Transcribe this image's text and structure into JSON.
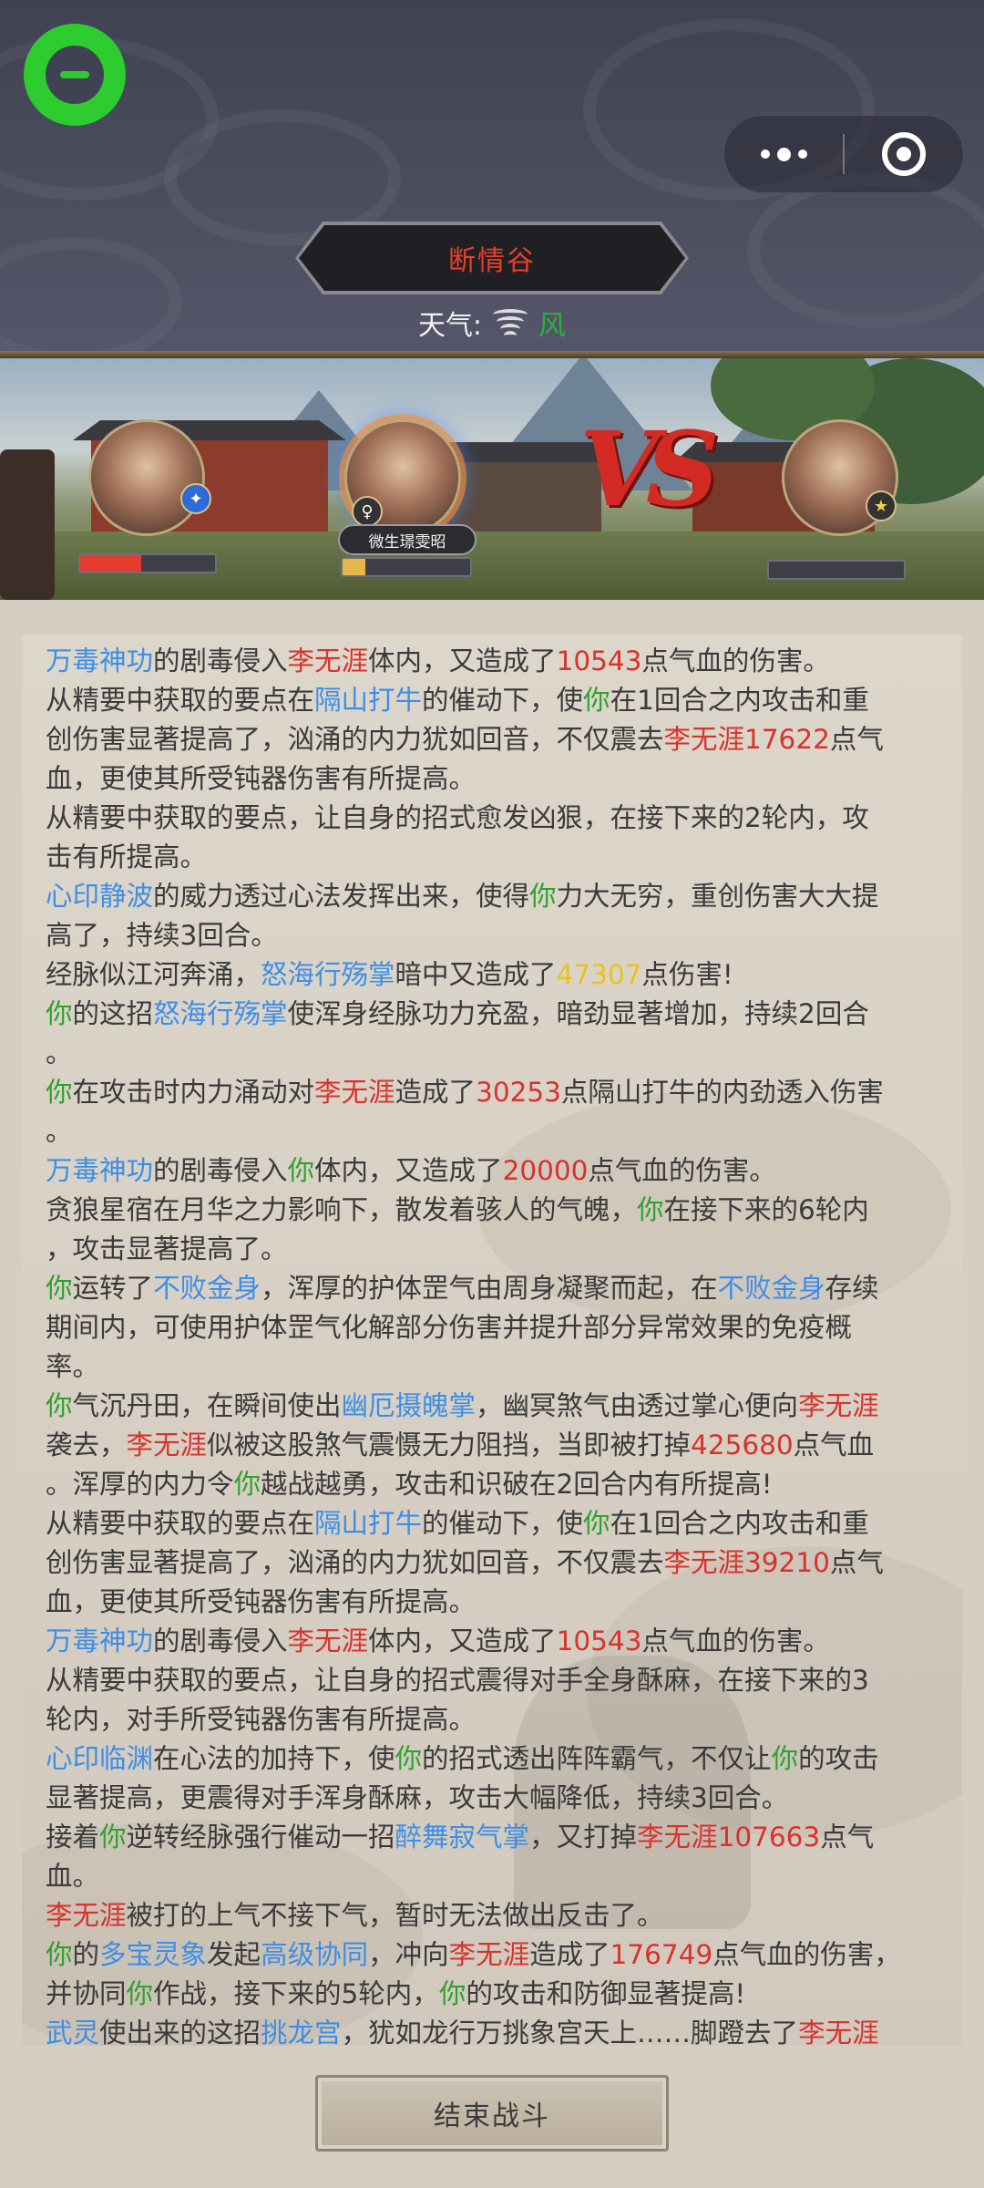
{
  "header": {
    "location": "断情谷",
    "weather_label": "天气:",
    "weather_value": "风",
    "weather_icon": "whirlwind-icon"
  },
  "battle_scene": {
    "fighters": [
      {
        "name": "",
        "hp_fraction": 0.45,
        "badge_icon": "water-element-icon"
      },
      {
        "name": "微生璟雯昭",
        "hp_fraction": 0.18,
        "badge_icon": "female-symbol-icon"
      },
      {
        "name": "",
        "hp_fraction": 0.0,
        "badge_icon": "star-icon"
      }
    ],
    "vs_text": "VS"
  },
  "colors": {
    "skill": "#3d8ee6",
    "enemy": "#d8322c",
    "self": "#2ea12e",
    "highlight": "#e8c21c"
  },
  "log": [
    [
      {
        "t": "万毒神功",
        "c": "blue"
      },
      {
        "t": "的剧毒侵入"
      },
      {
        "t": "李无涯",
        "c": "red"
      },
      {
        "t": "体内，又造成了"
      },
      {
        "t": "10543",
        "c": "red"
      },
      {
        "t": "点气血的伤害。"
      }
    ],
    [
      {
        "t": "从精要中获取的要点在"
      },
      {
        "t": "隔山打牛",
        "c": "blue"
      },
      {
        "t": "的催动下，使"
      },
      {
        "t": "你",
        "c": "green"
      },
      {
        "t": "在1回合之内攻击和重"
      }
    ],
    [
      {
        "t": "创伤害显著提高了，汹涌的内力犹如回音，不仅震去"
      },
      {
        "t": "李无涯17622",
        "c": "red"
      },
      {
        "t": "点气"
      }
    ],
    [
      {
        "t": "血，更使其所受钝器伤害有所提高。"
      }
    ],
    [
      {
        "t": "从精要中获取的要点，让自身的招式愈发凶狠，在接下来的2轮内，攻"
      }
    ],
    [
      {
        "t": "击有所提高。"
      }
    ],
    [
      {
        "t": "心印静波",
        "c": "blue"
      },
      {
        "t": "的威力透过心法发挥出来，使得"
      },
      {
        "t": "你",
        "c": "green"
      },
      {
        "t": "力大无穷，重创伤害大大提"
      }
    ],
    [
      {
        "t": "高了，持续3回合。"
      }
    ],
    [
      {
        "t": "经脉似江河奔涌，"
      },
      {
        "t": "怒海行殇掌",
        "c": "blue"
      },
      {
        "t": "暗中又造成了"
      },
      {
        "t": "47307",
        "c": "yellow"
      },
      {
        "t": "点伤害!"
      }
    ],
    [
      {
        "t": "你",
        "c": "green"
      },
      {
        "t": "的这招"
      },
      {
        "t": "怒海行殇掌",
        "c": "blue"
      },
      {
        "t": "使浑身经脉功力充盈，暗劲显著增加，持续2回合"
      }
    ],
    [
      {
        "t": "。"
      }
    ],
    [
      {
        "t": "你",
        "c": "green"
      },
      {
        "t": "在攻击时内力涌动对"
      },
      {
        "t": "李无涯",
        "c": "red"
      },
      {
        "t": "造成了"
      },
      {
        "t": "30253",
        "c": "red"
      },
      {
        "t": "点隔山打牛的内劲透入伤害"
      }
    ],
    [
      {
        "t": "。"
      }
    ],
    [
      {
        "t": "万毒神功",
        "c": "blue"
      },
      {
        "t": "的剧毒侵入"
      },
      {
        "t": "你",
        "c": "green"
      },
      {
        "t": "体内，又造成了"
      },
      {
        "t": "20000",
        "c": "red"
      },
      {
        "t": "点气血的伤害。"
      }
    ],
    [
      {
        "t": "贪狼星宿在月华之力影响下，散发着骇人的气魄，"
      },
      {
        "t": "你",
        "c": "green"
      },
      {
        "t": "在接下来的6轮内"
      }
    ],
    [
      {
        "t": "，攻击显著提高了。"
      }
    ],
    [
      {
        "t": "你",
        "c": "green"
      },
      {
        "t": "运转了"
      },
      {
        "t": "不败金身",
        "c": "blue"
      },
      {
        "t": "，浑厚的护体罡气由周身凝聚而起，在"
      },
      {
        "t": "不败金身",
        "c": "blue"
      },
      {
        "t": "存续"
      }
    ],
    [
      {
        "t": "期间内，可使用护体罡气化解部分伤害并提升部分异常效果的免疫概"
      }
    ],
    [
      {
        "t": "率。"
      }
    ],
    [
      {
        "t": "你",
        "c": "green"
      },
      {
        "t": "气沉丹田，在瞬间使出"
      },
      {
        "t": "幽厄摄魄掌",
        "c": "blue"
      },
      {
        "t": "，幽冥煞气由透过掌心便向"
      },
      {
        "t": "李无涯",
        "c": "red"
      }
    ],
    [
      {
        "t": "袭去，"
      },
      {
        "t": "李无涯",
        "c": "red"
      },
      {
        "t": "似被这股煞气震慑无力阻挡，当即被打掉"
      },
      {
        "t": "425680",
        "c": "red"
      },
      {
        "t": "点气血"
      }
    ],
    [
      {
        "t": "。浑厚的内力令"
      },
      {
        "t": "你",
        "c": "green"
      },
      {
        "t": "越战越勇，攻击和识破在2回合内有所提高!"
      }
    ],
    [
      {
        "t": "从精要中获取的要点在"
      },
      {
        "t": "隔山打牛",
        "c": "blue"
      },
      {
        "t": "的催动下，使"
      },
      {
        "t": "你",
        "c": "green"
      },
      {
        "t": "在1回合之内攻击和重"
      }
    ],
    [
      {
        "t": "创伤害显著提高了，汹涌的内力犹如回音，不仅震去"
      },
      {
        "t": "李无涯39210",
        "c": "red"
      },
      {
        "t": "点气"
      }
    ],
    [
      {
        "t": "血，更使其所受钝器伤害有所提高。"
      }
    ],
    [
      {
        "t": "万毒神功",
        "c": "blue"
      },
      {
        "t": "的剧毒侵入"
      },
      {
        "t": "李无涯",
        "c": "red"
      },
      {
        "t": "体内，又造成了"
      },
      {
        "t": "10543",
        "c": "red"
      },
      {
        "t": "点气血的伤害。"
      }
    ],
    [
      {
        "t": "从精要中获取的要点，让自身的招式震得对手全身酥麻，在接下来的3"
      }
    ],
    [
      {
        "t": "轮内，对手所受钝器伤害有所提高。"
      }
    ],
    [
      {
        "t": "心印临渊",
        "c": "blue"
      },
      {
        "t": "在心法的加持下，使"
      },
      {
        "t": "你",
        "c": "green"
      },
      {
        "t": "的招式透出阵阵霸气，不仅让"
      },
      {
        "t": "你",
        "c": "green"
      },
      {
        "t": "的攻击"
      }
    ],
    [
      {
        "t": "显著提高，更震得对手浑身酥麻，攻击大幅降低，持续3回合。"
      }
    ],
    [
      {
        "t": "接着"
      },
      {
        "t": "你",
        "c": "green"
      },
      {
        "t": "逆转经脉强行催动一招"
      },
      {
        "t": "醉舞寂气掌",
        "c": "blue"
      },
      {
        "t": "，又打掉"
      },
      {
        "t": "李无涯107663",
        "c": "red"
      },
      {
        "t": "点气"
      }
    ],
    [
      {
        "t": "血。"
      }
    ],
    [
      {
        "t": "李无涯",
        "c": "red"
      },
      {
        "t": "被打的上气不接下气，暂时无法做出反击了。"
      }
    ],
    [
      {
        "t": "你",
        "c": "green"
      },
      {
        "t": "的"
      },
      {
        "t": "多宝灵象",
        "c": "blue"
      },
      {
        "t": "发起"
      },
      {
        "t": "高级协同",
        "c": "blue"
      },
      {
        "t": "，冲向"
      },
      {
        "t": "李无涯",
        "c": "red"
      },
      {
        "t": "造成了"
      },
      {
        "t": "176749",
        "c": "red"
      },
      {
        "t": "点气血的伤害，"
      }
    ],
    [
      {
        "t": "并协同"
      },
      {
        "t": "你",
        "c": "green"
      },
      {
        "t": "作战，接下来的5轮内，"
      },
      {
        "t": "你",
        "c": "green"
      },
      {
        "t": "的攻击和防御显著提高!"
      }
    ],
    [
      {
        "t": "武灵",
        "c": "blue"
      },
      {
        "t": "使出来的这招"
      },
      {
        "t": "挑龙宫",
        "c": "blue"
      },
      {
        "t": "，犹如龙行万挑象宫天上……脚蹬去了"
      },
      {
        "t": "李无涯",
        "c": "red"
      }
    ]
  ],
  "footer": {
    "end_battle_label": "结束战斗"
  }
}
